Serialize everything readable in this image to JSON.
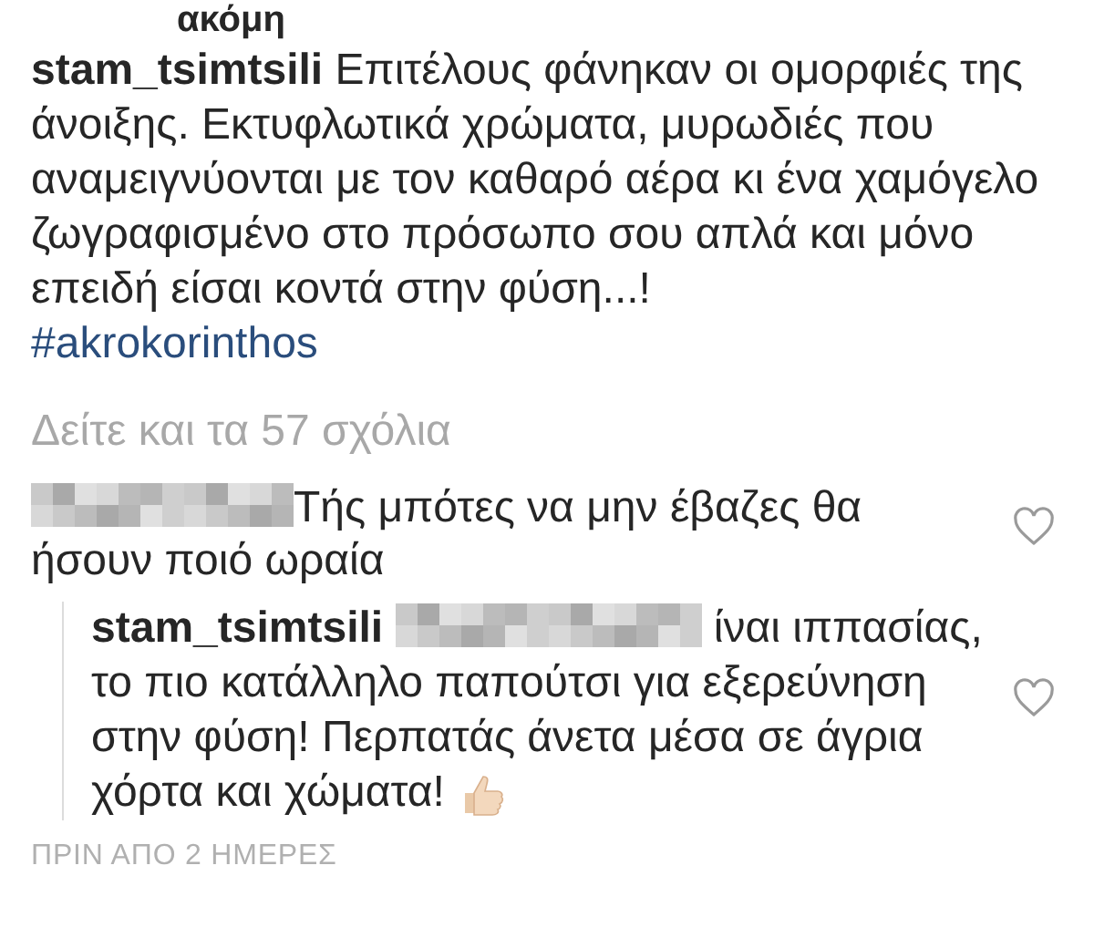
{
  "top_cut_text": "ακόμη",
  "caption": {
    "text": "**stam_tsimtsili** Επιτέλους φάνηκαν οι ομορφιές της άνοιξης. Εκτυφλωτικά χρώματα, μυρωδιές που αναμειγνύονται με τον καθαρό αέρα κι ένα χαμόγελο ζωγραφισμένο στο πρόσωπο σου απλά και μόνο επειδή είσαι κοντά στην φύση...!",
    "hashtag": "#akrokorinthos"
  },
  "view_comments": "Δείτε και τα 57 σχόλια",
  "comment": {
    "text": "Τής μπότες να μην έβαζες θα ήσουν ποιό ωραία",
    "liked": false
  },
  "reply": {
    "author": "stam_tsimtsili",
    "text": "ίναι ιππασίας, το πιο κατάλληλο παπούτσι για εξερεύνηση στην φύση! Περπατάς άνετα μέσα σε άγρια χόρτα και χώματα!",
    "liked": false
  },
  "timestamp": "ΠΡΙΝ ΑΠΟ 2 ΗΜΕΡΕΣ"
}
